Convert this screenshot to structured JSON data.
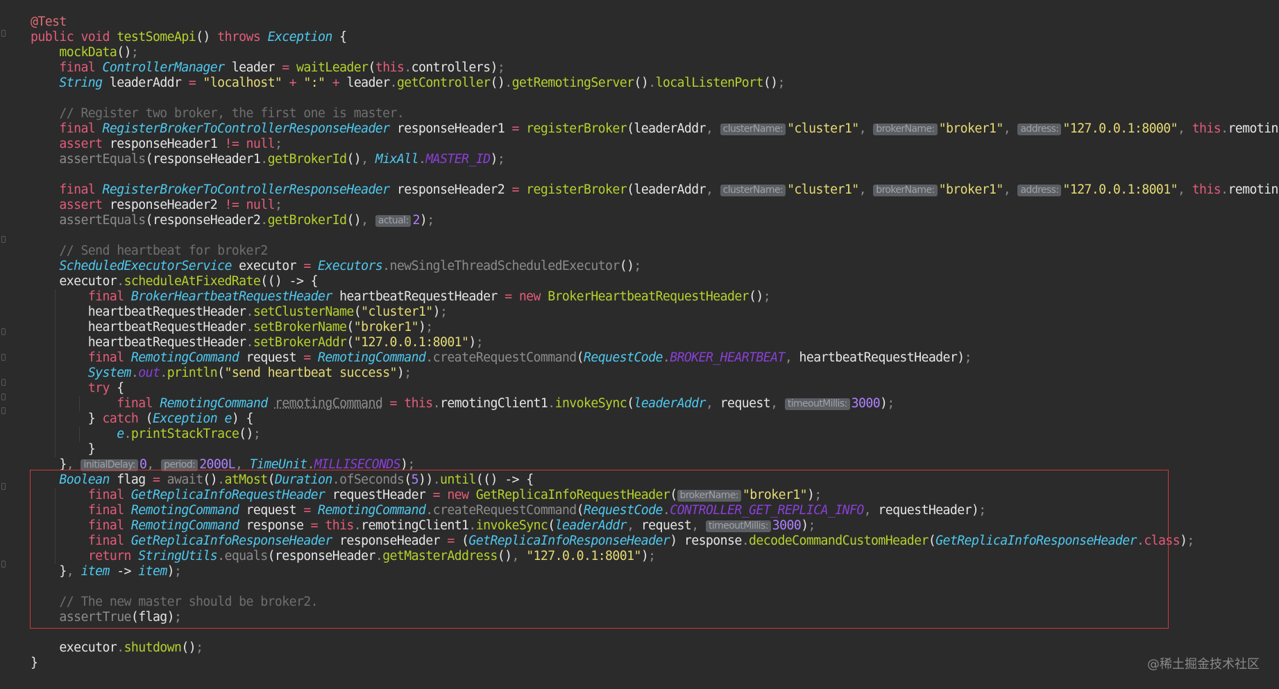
{
  "lines": [
    [
      [
        "annot",
        "@Test"
      ]
    ],
    [
      [
        "kw",
        "public "
      ],
      [
        "kw",
        "void "
      ],
      [
        "fn",
        "testSomeApi"
      ],
      [
        "t",
        "() "
      ],
      [
        "kw",
        "throws "
      ],
      [
        "type",
        "Exception"
      ],
      [
        "t",
        " {"
      ]
    ],
    [
      [
        "t",
        "    "
      ],
      [
        "fn",
        "mockData"
      ],
      [
        "t",
        "()"
      ],
      [
        "mut",
        ";"
      ]
    ],
    [
      [
        "t",
        "    "
      ],
      [
        "kw",
        "final "
      ],
      [
        "type",
        "ControllerManager"
      ],
      [
        "t",
        " leader "
      ],
      [
        "op",
        "= "
      ],
      [
        "fn",
        "waitLeader"
      ],
      [
        "t",
        "("
      ],
      [
        "kw",
        "this"
      ],
      [
        "mut",
        "."
      ],
      [
        "t",
        "controllers)"
      ],
      [
        "mut",
        ";"
      ]
    ],
    [
      [
        "t",
        "    "
      ],
      [
        "type",
        "String"
      ],
      [
        "t",
        " leaderAddr "
      ],
      [
        "op",
        "= "
      ],
      [
        "str",
        "\"localhost\""
      ],
      [
        "op",
        " + "
      ],
      [
        "str",
        "\":\""
      ],
      [
        "op",
        " + "
      ],
      [
        "t",
        "leader"
      ],
      [
        "mut",
        "."
      ],
      [
        "fn",
        "getController"
      ],
      [
        "t",
        "()"
      ],
      [
        "mut",
        "."
      ],
      [
        "fn",
        "getRemotingServer"
      ],
      [
        "t",
        "()"
      ],
      [
        "mut",
        "."
      ],
      [
        "fn",
        "localListenPort"
      ],
      [
        "t",
        "()"
      ],
      [
        "mut",
        ";"
      ]
    ],
    [],
    [
      [
        "t",
        "    "
      ],
      [
        "cmt",
        "// Register two broker, the first one is master."
      ]
    ],
    [
      [
        "t",
        "    "
      ],
      [
        "kw",
        "final "
      ],
      [
        "type",
        "RegisterBrokerToControllerResponseHeader"
      ],
      [
        "t",
        " responseHeader1 "
      ],
      [
        "op",
        "= "
      ],
      [
        "fn",
        "registerBroker"
      ],
      [
        "t",
        "(leaderAddr"
      ],
      [
        "mut",
        ", "
      ],
      [
        "hint",
        "clusterName:"
      ],
      [
        "str",
        "\"cluster1\""
      ],
      [
        "mut",
        ", "
      ],
      [
        "hint",
        "brokerName:"
      ],
      [
        "str",
        "\"broker1\""
      ],
      [
        "mut",
        ", "
      ],
      [
        "hint",
        "address:"
      ],
      [
        "str",
        "\"127.0.0.1:8000\""
      ],
      [
        "mut",
        ", "
      ],
      [
        "kw",
        "this"
      ],
      [
        "mut",
        "."
      ],
      [
        "t",
        "remotingC"
      ]
    ],
    [
      [
        "t",
        "    "
      ],
      [
        "kw",
        "assert "
      ],
      [
        "t",
        "responseHeader1 "
      ],
      [
        "op",
        "!= "
      ],
      [
        "kw",
        "null"
      ],
      [
        "mut",
        ";"
      ]
    ],
    [
      [
        "t",
        "    "
      ],
      [
        "mut",
        "assertEquals"
      ],
      [
        "t",
        "(responseHeader1"
      ],
      [
        "mut",
        "."
      ],
      [
        "fn",
        "getBrokerId"
      ],
      [
        "t",
        "()"
      ],
      [
        "mut",
        ", "
      ],
      [
        "type",
        "MixAll"
      ],
      [
        "mut",
        "."
      ],
      [
        "const",
        "MASTER_ID"
      ],
      [
        "t",
        ")"
      ],
      [
        "mut",
        ";"
      ]
    ],
    [],
    [
      [
        "t",
        "    "
      ],
      [
        "kw",
        "final "
      ],
      [
        "type",
        "RegisterBrokerToControllerResponseHeader"
      ],
      [
        "t",
        " responseHeader2 "
      ],
      [
        "op",
        "= "
      ],
      [
        "fn",
        "registerBroker"
      ],
      [
        "t",
        "(leaderAddr"
      ],
      [
        "mut",
        ", "
      ],
      [
        "hint",
        "clusterName:"
      ],
      [
        "str",
        "\"cluster1\""
      ],
      [
        "mut",
        ", "
      ],
      [
        "hint",
        "brokerName:"
      ],
      [
        "str",
        "\"broker1\""
      ],
      [
        "mut",
        ", "
      ],
      [
        "hint",
        "address:"
      ],
      [
        "str",
        "\"127.0.0.1:8001\""
      ],
      [
        "mut",
        ", "
      ],
      [
        "kw",
        "this"
      ],
      [
        "mut",
        "."
      ],
      [
        "t",
        "remotingC"
      ]
    ],
    [
      [
        "t",
        "    "
      ],
      [
        "kw",
        "assert "
      ],
      [
        "t",
        "responseHeader2 "
      ],
      [
        "op",
        "!= "
      ],
      [
        "kw",
        "null"
      ],
      [
        "mut",
        ";"
      ]
    ],
    [
      [
        "t",
        "    "
      ],
      [
        "mut",
        "assertEquals"
      ],
      [
        "t",
        "(responseHeader2"
      ],
      [
        "mut",
        "."
      ],
      [
        "fn",
        "getBrokerId"
      ],
      [
        "t",
        "()"
      ],
      [
        "mut",
        ", "
      ],
      [
        "hint",
        "actual:"
      ],
      [
        "num",
        "2"
      ],
      [
        "t",
        ")"
      ],
      [
        "mut",
        ";"
      ]
    ],
    [],
    [
      [
        "t",
        "    "
      ],
      [
        "cmt",
        "// Send heartbeat for broker2"
      ]
    ],
    [
      [
        "t",
        "    "
      ],
      [
        "type",
        "ScheduledExecutorService"
      ],
      [
        "t",
        " executor "
      ],
      [
        "op",
        "= "
      ],
      [
        "type",
        "Executors"
      ],
      [
        "mut",
        ".newSingleThreadScheduledExecutor"
      ],
      [
        "t",
        "()"
      ],
      [
        "mut",
        ";"
      ]
    ],
    [
      [
        "t",
        "    executor"
      ],
      [
        "mut",
        "."
      ],
      [
        "fn",
        "scheduleAtFixedRate"
      ],
      [
        "t",
        "(() -> {"
      ]
    ],
    [
      [
        "t",
        "        "
      ],
      [
        "kw",
        "final "
      ],
      [
        "type",
        "BrokerHeartbeatRequestHeader"
      ],
      [
        "t",
        " heartbeatRequestHeader "
      ],
      [
        "op",
        "= "
      ],
      [
        "kw",
        "new "
      ],
      [
        "fn",
        "BrokerHeartbeatRequestHeader"
      ],
      [
        "t",
        "()"
      ],
      [
        "mut",
        ";"
      ]
    ],
    [
      [
        "t",
        "        heartbeatRequestHeader"
      ],
      [
        "mut",
        "."
      ],
      [
        "fn",
        "setClusterName"
      ],
      [
        "t",
        "("
      ],
      [
        "str",
        "\"cluster1\""
      ],
      [
        "t",
        ")"
      ],
      [
        "mut",
        ";"
      ]
    ],
    [
      [
        "t",
        "        heartbeatRequestHeader"
      ],
      [
        "mut",
        "."
      ],
      [
        "fn",
        "setBrokerName"
      ],
      [
        "t",
        "("
      ],
      [
        "str",
        "\"broker1\""
      ],
      [
        "t",
        ")"
      ],
      [
        "mut",
        ";"
      ]
    ],
    [
      [
        "t",
        "        heartbeatRequestHeader"
      ],
      [
        "mut",
        "."
      ],
      [
        "fn",
        "setBrokerAddr"
      ],
      [
        "t",
        "("
      ],
      [
        "str",
        "\"127.0.0.1:8001\""
      ],
      [
        "t",
        ")"
      ],
      [
        "mut",
        ";"
      ]
    ],
    [
      [
        "t",
        "        "
      ],
      [
        "kw",
        "final "
      ],
      [
        "type",
        "RemotingCommand"
      ],
      [
        "t",
        " request "
      ],
      [
        "op",
        "= "
      ],
      [
        "type",
        "RemotingCommand"
      ],
      [
        "mut",
        ".createRequestCommand"
      ],
      [
        "t",
        "("
      ],
      [
        "type",
        "RequestCode"
      ],
      [
        "mut",
        "."
      ],
      [
        "const",
        "BROKER_HEARTBEAT"
      ],
      [
        "mut",
        ", "
      ],
      [
        "t",
        "heartbeatRequestHeader)"
      ],
      [
        "mut",
        ";"
      ]
    ],
    [
      [
        "t",
        "        "
      ],
      [
        "type",
        "System"
      ],
      [
        "mut",
        "."
      ],
      [
        "const",
        "out"
      ],
      [
        "mut",
        "."
      ],
      [
        "fn",
        "println"
      ],
      [
        "t",
        "("
      ],
      [
        "str",
        "\"send heartbeat success\""
      ],
      [
        "t",
        ")"
      ],
      [
        "mut",
        ";"
      ]
    ],
    [
      [
        "t",
        "        "
      ],
      [
        "kw",
        "try"
      ],
      [
        "t",
        " {"
      ]
    ],
    [
      [
        "t",
        "            "
      ],
      [
        "kw",
        "final "
      ],
      [
        "type",
        "RemotingCommand"
      ],
      [
        "t",
        " "
      ],
      [
        "und",
        "remotingCommand"
      ],
      [
        "t",
        " "
      ],
      [
        "op",
        "= "
      ],
      [
        "kw",
        "this"
      ],
      [
        "mut",
        "."
      ],
      [
        "t",
        "remotingClient1"
      ],
      [
        "mut",
        "."
      ],
      [
        "fn",
        "invokeSync"
      ],
      [
        "t",
        "("
      ],
      [
        "ivar",
        "leaderAddr"
      ],
      [
        "mut",
        ", "
      ],
      [
        "t",
        "request"
      ],
      [
        "mut",
        ", "
      ],
      [
        "hint",
        "timeoutMillis:"
      ],
      [
        "num",
        "3000"
      ],
      [
        "t",
        ")"
      ],
      [
        "mut",
        ";"
      ]
    ],
    [
      [
        "t",
        "        } "
      ],
      [
        "kw",
        "catch "
      ],
      [
        "t",
        "("
      ],
      [
        "type",
        "Exception"
      ],
      [
        "t",
        " "
      ],
      [
        "ivar",
        "e"
      ],
      [
        "t",
        ") {"
      ]
    ],
    [
      [
        "t",
        "            "
      ],
      [
        "ivar",
        "e"
      ],
      [
        "mut",
        "."
      ],
      [
        "fn",
        "printStackTrace"
      ],
      [
        "t",
        "()"
      ],
      [
        "mut",
        ";"
      ]
    ],
    [
      [
        "t",
        "        }"
      ]
    ],
    [
      [
        "t",
        "    }"
      ],
      [
        "mut",
        ", "
      ],
      [
        "hint",
        "initialDelay:"
      ],
      [
        "num",
        "0"
      ],
      [
        "mut",
        ", "
      ],
      [
        "hint",
        "period:"
      ],
      [
        "num",
        "2000L"
      ],
      [
        "mut",
        ", "
      ],
      [
        "type",
        "TimeUnit"
      ],
      [
        "mut",
        "."
      ],
      [
        "const",
        "MILLISECONDS"
      ],
      [
        "t",
        ")"
      ],
      [
        "mut",
        ";"
      ]
    ],
    [
      [
        "t",
        "    "
      ],
      [
        "type",
        "Boolean"
      ],
      [
        "t",
        " flag "
      ],
      [
        "op",
        "= "
      ],
      [
        "mut",
        "await"
      ],
      [
        "t",
        "()"
      ],
      [
        "mut",
        "."
      ],
      [
        "fn",
        "atMost"
      ],
      [
        "t",
        "("
      ],
      [
        "type",
        "Duration"
      ],
      [
        "mut",
        ".ofSeconds"
      ],
      [
        "t",
        "("
      ],
      [
        "num",
        "5"
      ],
      [
        "t",
        "))"
      ],
      [
        "mut",
        "."
      ],
      [
        "fn",
        "until"
      ],
      [
        "t",
        "(() -> {"
      ]
    ],
    [
      [
        "t",
        "        "
      ],
      [
        "kw",
        "final "
      ],
      [
        "type",
        "GetReplicaInfoRequestHeader"
      ],
      [
        "t",
        " requestHeader "
      ],
      [
        "op",
        "= "
      ],
      [
        "kw",
        "new "
      ],
      [
        "fn",
        "GetReplicaInfoRequestHeader"
      ],
      [
        "t",
        "("
      ],
      [
        "hint",
        "brokerName:"
      ],
      [
        "str",
        "\"broker1\""
      ],
      [
        "t",
        ")"
      ],
      [
        "mut",
        ";"
      ]
    ],
    [
      [
        "t",
        "        "
      ],
      [
        "kw",
        "final "
      ],
      [
        "type",
        "RemotingCommand"
      ],
      [
        "t",
        " request "
      ],
      [
        "op",
        "= "
      ],
      [
        "type",
        "RemotingCommand"
      ],
      [
        "mut",
        ".createRequestCommand"
      ],
      [
        "t",
        "("
      ],
      [
        "type",
        "RequestCode"
      ],
      [
        "mut",
        "."
      ],
      [
        "const",
        "CONTROLLER_GET_REPLICA_INFO"
      ],
      [
        "mut",
        ", "
      ],
      [
        "t",
        "requestHeader)"
      ],
      [
        "mut",
        ";"
      ]
    ],
    [
      [
        "t",
        "        "
      ],
      [
        "kw",
        "final "
      ],
      [
        "type",
        "RemotingCommand"
      ],
      [
        "t",
        " response "
      ],
      [
        "op",
        "= "
      ],
      [
        "kw",
        "this"
      ],
      [
        "mut",
        "."
      ],
      [
        "t",
        "remotingClient1"
      ],
      [
        "mut",
        "."
      ],
      [
        "fn",
        "invokeSync"
      ],
      [
        "t",
        "("
      ],
      [
        "ivar",
        "leaderAddr"
      ],
      [
        "mut",
        ", "
      ],
      [
        "t",
        "request"
      ],
      [
        "mut",
        ", "
      ],
      [
        "hint",
        "timeoutMillis:"
      ],
      [
        "num",
        "3000"
      ],
      [
        "t",
        ")"
      ],
      [
        "mut",
        ";"
      ]
    ],
    [
      [
        "t",
        "        "
      ],
      [
        "kw",
        "final "
      ],
      [
        "type",
        "GetReplicaInfoResponseHeader"
      ],
      [
        "t",
        " responseHeader "
      ],
      [
        "op",
        "= "
      ],
      [
        "t",
        "("
      ],
      [
        "type",
        "GetReplicaInfoResponseHeader"
      ],
      [
        "t",
        ") response"
      ],
      [
        "mut",
        "."
      ],
      [
        "fn",
        "decodeCommandCustomHeader"
      ],
      [
        "t",
        "("
      ],
      [
        "type",
        "GetReplicaInfoResponseHeader"
      ],
      [
        "mut",
        "."
      ],
      [
        "kw",
        "class"
      ],
      [
        "t",
        ")"
      ],
      [
        "mut",
        ";"
      ]
    ],
    [
      [
        "t",
        "        "
      ],
      [
        "kw",
        "return "
      ],
      [
        "type",
        "StringUtils"
      ],
      [
        "mut",
        ".equals"
      ],
      [
        "t",
        "(responseHeader"
      ],
      [
        "mut",
        "."
      ],
      [
        "fn",
        "getMasterAddress"
      ],
      [
        "t",
        "()"
      ],
      [
        "mut",
        ", "
      ],
      [
        "str",
        "\"127.0.0.1:8001\""
      ],
      [
        "t",
        ")"
      ],
      [
        "mut",
        ";"
      ]
    ],
    [
      [
        "t",
        "    }"
      ],
      [
        "mut",
        ", "
      ],
      [
        "ivar",
        "item"
      ],
      [
        "t",
        " -> "
      ],
      [
        "ivar",
        "item"
      ],
      [
        "t",
        ")"
      ],
      [
        "mut",
        ";"
      ]
    ],
    [],
    [
      [
        "t",
        "    "
      ],
      [
        "cmt",
        "// The new master should be broker2."
      ]
    ],
    [
      [
        "t",
        "    "
      ],
      [
        "mut",
        "assertTrue"
      ],
      [
        "t",
        "(flag)"
      ],
      [
        "mut",
        ";"
      ]
    ],
    [],
    [
      [
        "t",
        "    executor"
      ],
      [
        "mut",
        "."
      ],
      [
        "fn",
        "shutdown"
      ],
      [
        "t",
        "()"
      ],
      [
        "mut",
        ";"
      ]
    ],
    [
      [
        "t",
        "}"
      ]
    ]
  ],
  "watermark": "@稀土掘金技术社区",
  "colors": {
    "background": "#2b2b2b",
    "keyword": "#e45c7a",
    "function": "#b5d22c",
    "type": "#4ec9f0",
    "string": "#e6db74",
    "number": "#ae81ff",
    "comment": "#6f6f6f",
    "constant": "#8b3fd9",
    "highlight_border": "#d0393c"
  },
  "highlighted_lines": "30-40"
}
